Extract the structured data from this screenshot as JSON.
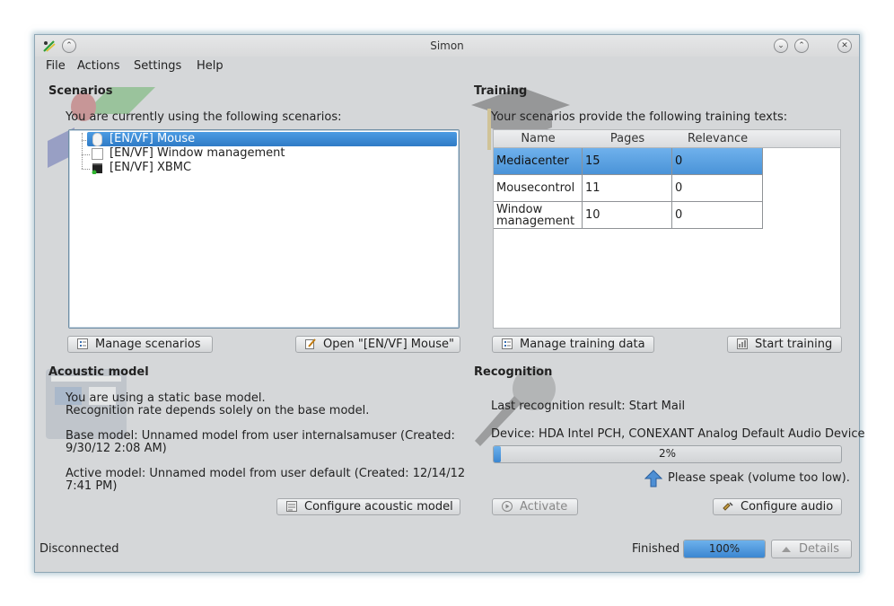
{
  "window": {
    "title": "Simon"
  },
  "menu": [
    "File",
    "Actions",
    "Settings",
    "Help"
  ],
  "scenarios": {
    "title": "Scenarios",
    "subtitle": "You are currently using the following scenarios:",
    "items": [
      {
        "label": "[EN/VF] Mouse",
        "icon": "mouse-icon",
        "selected": true
      },
      {
        "label": "[EN/VF] Window management",
        "icon": "window-icon",
        "selected": false
      },
      {
        "label": "[EN/VF] XBMC",
        "icon": "media-icon",
        "selected": false
      }
    ],
    "manage_button": "Manage scenarios",
    "open_button": "Open \"[EN/VF] Mouse\""
  },
  "training": {
    "title": "Training",
    "subtitle": "Your scenarios provide the following training texts:",
    "columns": [
      "Name",
      "Pages",
      "Relevance"
    ],
    "rows": [
      {
        "name": "Mediacenter",
        "pages": "15",
        "relevance": "0",
        "selected": true
      },
      {
        "name": "Mousecontrol",
        "pages": "11",
        "relevance": "0",
        "selected": false
      },
      {
        "name": "Window management",
        "pages": "10",
        "relevance": "0",
        "selected": false
      }
    ],
    "manage_button": "Manage training data",
    "start_button": "Start training"
  },
  "acoustic": {
    "title": "Acoustic model",
    "line1": "You are using a static base model.",
    "line2": "Recognition rate depends solely on the base model.",
    "base_model_1": "Base model: Unnamed model from user internalsamuser (Created:",
    "base_model_2": "9/30/12 2:08 AM)",
    "active_model_1": "Active model: Unnamed model from user default (Created: 12/14/12",
    "active_model_2": "7:41 PM)",
    "configure_button": "Configure acoustic model"
  },
  "recognition": {
    "title": "Recognition",
    "last_result": "Last recognition result: Start Mail",
    "device": "Device: HDA Intel PCH, CONEXANT Analog Default Audio Device",
    "volume_percent": 2,
    "volume_text": "2%",
    "hint": "Please speak (volume too low).",
    "activate_button": "Activate",
    "configure_audio_button": "Configure audio"
  },
  "status": {
    "connection": "Disconnected",
    "finished_label": "Finished",
    "progress_percent": 100,
    "progress_text": "100%",
    "details_button": "Details"
  },
  "colors": {
    "selection": "#3a87d3",
    "window_bg": "#d5d7d9"
  }
}
